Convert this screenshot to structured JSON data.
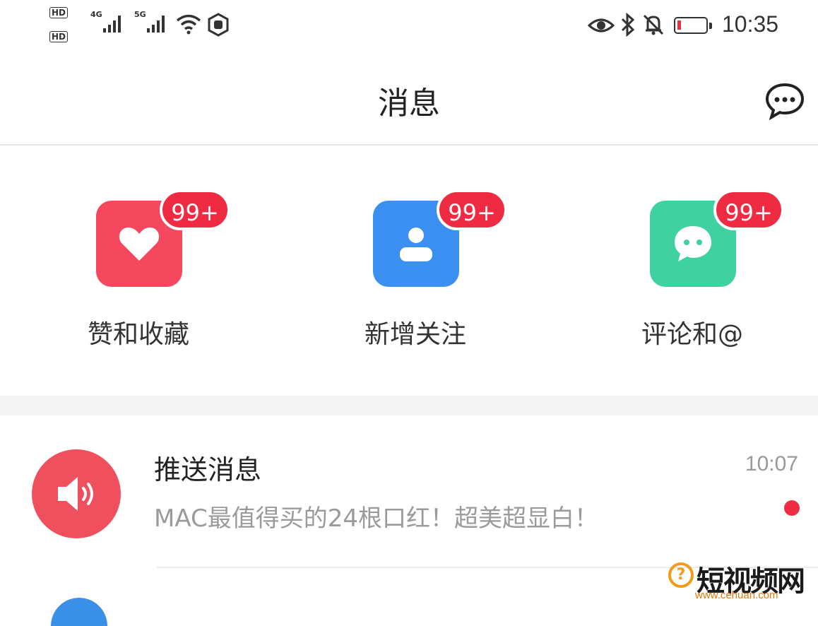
{
  "status_bar": {
    "hd_badges": [
      "HD",
      "HD"
    ],
    "sim1_label": "4G",
    "sim2_label": "5G",
    "time": "10:35",
    "battery_level": 0.12,
    "icons": [
      "signal-icon",
      "wifi-icon",
      "eye-icon",
      "bluetooth-icon",
      "bell-off-icon",
      "battery-icon"
    ]
  },
  "header": {
    "title": "消息",
    "right_icon": "chat-bubble-icon"
  },
  "shortcuts": [
    {
      "label": "赞和收藏",
      "badge": "99+",
      "color": "#f5475e",
      "icon": "heart-icon"
    },
    {
      "label": "新增关注",
      "badge": "99+",
      "color": "#3a8ff0",
      "icon": "user-icon"
    },
    {
      "label": "评论和@",
      "badge": "99+",
      "color": "#3fd1a0",
      "icon": "comment-icon"
    }
  ],
  "messages": [
    {
      "title": "推送消息",
      "time": "10:07",
      "preview": "MAC最值得买的24根口红！超美超显白！",
      "unread": true,
      "avatar_color": "#f0505e",
      "avatar_icon": "speaker-icon"
    }
  ],
  "watermark": {
    "mark": "?",
    "main_text": "短视频网",
    "url": "www.cehuan.com"
  }
}
